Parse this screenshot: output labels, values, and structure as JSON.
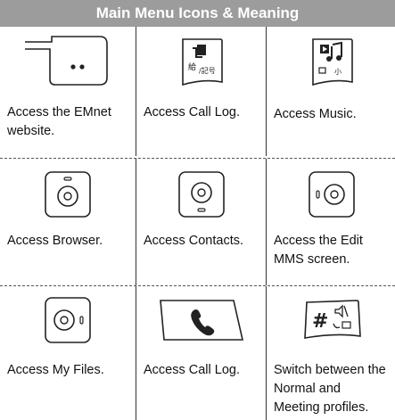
{
  "header": {
    "title": "Main Menu Icons & Meaning"
  },
  "rows": [
    {
      "cells": [
        {
          "icon": "emnet-key-icon",
          "caption": "Access the EMnet website."
        },
        {
          "icon": "call-log-key-icon",
          "caption": "Access Call Log."
        },
        {
          "icon": "music-key-icon",
          "caption": "Access Music."
        }
      ]
    },
    {
      "cells": [
        {
          "icon": "browser-key-icon",
          "caption": "Access Browser."
        },
        {
          "icon": "contacts-key-icon",
          "caption": "Access Contacts."
        },
        {
          "icon": "edit-mms-key-icon",
          "caption": "Access the Edit MMS screen."
        }
      ]
    },
    {
      "cells": [
        {
          "icon": "my-files-key-icon",
          "caption": "Access My Files."
        },
        {
          "icon": "call-key-icon",
          "caption": "Access Call Log."
        },
        {
          "icon": "hash-profile-key-icon",
          "caption": "Switch between the Normal and Meeting profiles."
        }
      ]
    }
  ],
  "colors": {
    "header_bg": "#9c9c9c",
    "header_text": "#ffffff"
  }
}
